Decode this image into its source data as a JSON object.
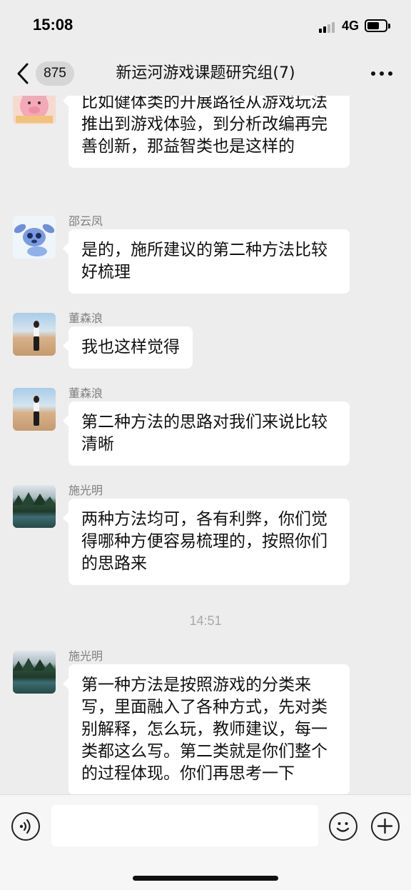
{
  "status_bar": {
    "time": "15:08",
    "network": "4G"
  },
  "nav": {
    "unread_count": "875",
    "title": "新运河游戏课题研究组(7)"
  },
  "messages": [
    {
      "sender": "",
      "avatar": "pig-avatar",
      "text": "比如健体类的开展路径从游戏玩法推出到游戏体验，到分析改编再完善创新，那益智类也是这样的"
    },
    {
      "sender": "邵云凤",
      "avatar": "stitch-avatar",
      "text": "是的，施所建议的第二种方法比较好梳理"
    },
    {
      "sender": "董森浪",
      "avatar": "desert-avatar",
      "text": "我也这样觉得"
    },
    {
      "sender": "董森浪",
      "avatar": "desert-avatar",
      "text": "第二种方法的思路对我们来说比较清晰"
    },
    {
      "sender": "施光明",
      "avatar": "forest-avatar",
      "text": "两种方法均可，各有利弊，你们觉得哪种方便容易梳理的，按照你们的思路来"
    },
    {
      "sender": "施光明",
      "avatar": "forest-avatar",
      "text": "第一种方法是按照游戏的分类来写，里面融入了各种方式，先对类别解释，怎么玩，教师建议，每一类都这么写。第二类就是你们整个的过程体现。你们再思考一下"
    }
  ],
  "time_separator": "14:51",
  "colors": {
    "background": "#ededed",
    "bubble": "#ffffff",
    "sender": "#808080"
  }
}
